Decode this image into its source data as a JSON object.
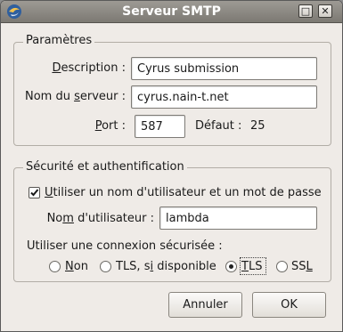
{
  "window": {
    "title": "Serveur SMTP"
  },
  "params": {
    "legend": "Paramètres",
    "description_label": {
      "pre": "",
      "key": "D",
      "post": "escription :"
    },
    "description_value": "Cyrus submission",
    "server_label": {
      "pre": "Nom du ",
      "key": "s",
      "post": "erveur :"
    },
    "server_value": "cyrus.nain-t.net",
    "port_label": {
      "pre": "",
      "key": "P",
      "post": "ort :"
    },
    "port_value": "587",
    "default_label": "Défaut :",
    "default_value": "25"
  },
  "security": {
    "legend": "Sécurité et authentification",
    "use_auth_label": {
      "pre": "",
      "key": "U",
      "post": "tiliser un nom d'utilisateur et un mot de passe"
    },
    "use_auth_checked": true,
    "username_label": {
      "pre": "No",
      "key": "m",
      "post": " d'utilisateur :"
    },
    "username_value": "lambda",
    "secure_conn_label": "Utiliser une connexion sécurisée :",
    "options": [
      {
        "pre": "",
        "key": "N",
        "post": "on",
        "selected": false
      },
      {
        "pre": "TLS, s",
        "key": "i",
        "post": " disponible",
        "selected": false
      },
      {
        "pre": "",
        "key": "T",
        "post": "LS",
        "selected": true
      },
      {
        "pre": "SS",
        "key": "L",
        "post": "",
        "selected": false
      }
    ]
  },
  "buttons": {
    "cancel": "Annuler",
    "ok": "OK"
  },
  "colors": {
    "titlebar": "#8a8780",
    "background": "#efebe7"
  }
}
